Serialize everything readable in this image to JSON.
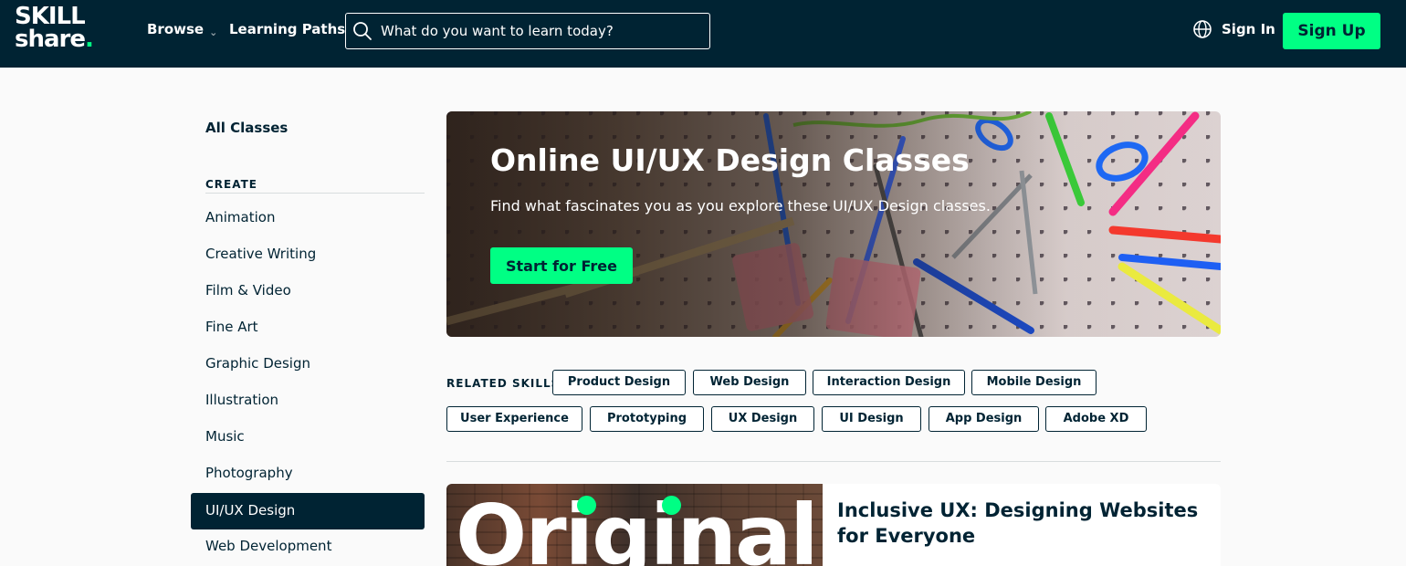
{
  "header": {
    "logo_line1": "SKILL",
    "logo_line2": "share",
    "logo_dot": ".",
    "browse_label": "Browse",
    "learning_paths_label": "Learning Paths",
    "search_placeholder": "What do you want to learn today?",
    "sign_in_label": "Sign In",
    "sign_up_label": "Sign Up",
    "accent_color": "#00ff84",
    "header_bg": "#002333"
  },
  "sidebar": {
    "all_classes": "All Classes",
    "section_heading": "CREATE",
    "items": [
      {
        "label": "Animation"
      },
      {
        "label": "Creative Writing"
      },
      {
        "label": "Film & Video"
      },
      {
        "label": "Fine Art"
      },
      {
        "label": "Graphic Design"
      },
      {
        "label": "Illustration"
      },
      {
        "label": "Music"
      },
      {
        "label": "Photography"
      },
      {
        "label": "UI/UX Design",
        "active": true
      },
      {
        "label": "Web Development"
      }
    ]
  },
  "hero": {
    "title": "Online UI/UX Design Classes",
    "subtitle": "Find what fascinates you as you explore these UI/UX Design classes.",
    "cta_label": "Start for Free"
  },
  "related_skills": {
    "label": "RELATED SKILLS",
    "chips": [
      "Product Design",
      "Web Design",
      "Interaction Design",
      "Mobile Design",
      "User Experience",
      "Prototyping",
      "UX Design",
      "UI Design",
      "App Design",
      "Adobe XD"
    ]
  },
  "class_card": {
    "thumbnail_text": "Original",
    "title": "Inclusive UX: Designing Websites for Everyone"
  }
}
